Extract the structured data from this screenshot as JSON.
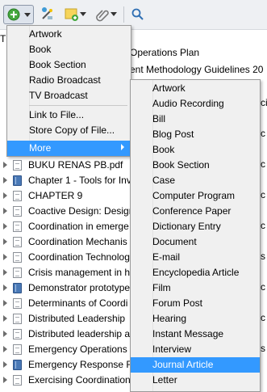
{
  "toolbar": {
    "new_item": "new-item-icon",
    "add_by_identifier": "magic-wand-icon",
    "new_note": "note-icon",
    "add_attachment": "paperclip-icon",
    "search": "search-icon"
  },
  "background": {
    "partial_col_letter": "T",
    "partial_titles": [
      "Operations Plan",
      "ent Methodology Guidelines 20"
    ],
    "right_fragments": [
      "ci",
      "c",
      "c",
      "c",
      "c",
      "s",
      "c",
      "c",
      "s"
    ]
  },
  "items": [
    {
      "title": "BUKU RENAS PB.pdf",
      "icon": "doc"
    },
    {
      "title": "Chapter 1 - Tools for Inv",
      "icon": "book"
    },
    {
      "title": "CHAPTER 9",
      "icon": "doc"
    },
    {
      "title": "Coactive Design: Designi",
      "icon": "doc"
    },
    {
      "title": "Coordination in emerge",
      "icon": "doc"
    },
    {
      "title": "Coordination Mechanis",
      "icon": "doc"
    },
    {
      "title": "Coordination Technolog",
      "icon": "doc"
    },
    {
      "title": "Crisis management in h",
      "icon": "doc"
    },
    {
      "title": "Demonstrator prototype",
      "icon": "book"
    },
    {
      "title": "Determinants of Coordi",
      "icon": "doc"
    },
    {
      "title": "Distributed Leadership",
      "icon": "doc"
    },
    {
      "title": "Distributed leadership a",
      "icon": "doc"
    },
    {
      "title": "Emergency Operations",
      "icon": "doc"
    },
    {
      "title": "Emergency Response Fr",
      "icon": "book"
    },
    {
      "title": "Exercising Coordination",
      "icon": "doc"
    }
  ],
  "menu": {
    "items": [
      "Artwork",
      "Book",
      "Book Section",
      "Radio Broadcast",
      "TV Broadcast"
    ],
    "link_file": "Link to File...",
    "store_copy": "Store Copy of File...",
    "more": "More"
  },
  "submenu": {
    "items": [
      "Artwork",
      "Audio Recording",
      "Bill",
      "Blog Post",
      "Book",
      "Book Section",
      "Case",
      "Computer Program",
      "Conference Paper",
      "Dictionary Entry",
      "Document",
      "E-mail",
      "Encyclopedia Article",
      "Film",
      "Forum Post",
      "Hearing",
      "Instant Message",
      "Interview",
      "Journal Article",
      "Letter"
    ],
    "highlighted": "Journal Article"
  },
  "colors": {
    "highlight": "#3399ff",
    "menu_bg": "#f0f0f0"
  }
}
